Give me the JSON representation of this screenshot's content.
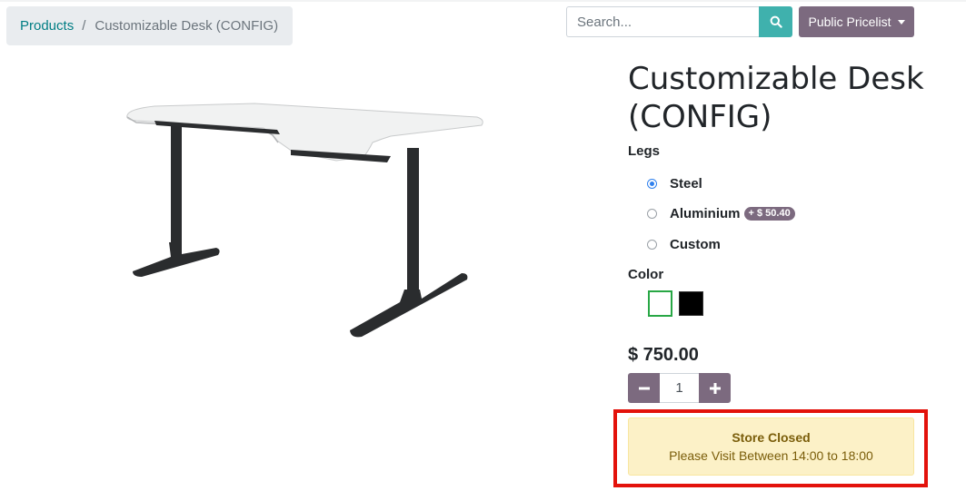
{
  "breadcrumb": {
    "parent": "Products",
    "separator": "/",
    "current": "Customizable Desk (CONFIG)"
  },
  "search": {
    "placeholder": "Search...",
    "value": ""
  },
  "pricelist": {
    "label": "Public Pricelist"
  },
  "product": {
    "title": "Customizable Desk (CONFIG)",
    "price": "$ 750.00",
    "quantity": "1",
    "image_icon": "desk-image"
  },
  "attributes": {
    "legs": {
      "label": "Legs",
      "options": [
        {
          "label": "Steel",
          "selected": true,
          "extra": ""
        },
        {
          "label": "Aluminium",
          "selected": false,
          "extra": "+ $ 50.40"
        },
        {
          "label": "Custom",
          "selected": false,
          "extra": ""
        }
      ]
    },
    "color": {
      "label": "Color",
      "options": [
        {
          "swatch": "#ffffff",
          "selected": true
        },
        {
          "swatch": "#000000",
          "selected": false
        }
      ]
    }
  },
  "alert": {
    "title": "Store Closed",
    "message": "Please Visit Between 14:00 to 18:00"
  },
  "colors": {
    "accent": "#7c6a7f",
    "search_button": "#3fb1ad",
    "link": "#017e84",
    "highlight_frame": "#e3120b",
    "alert_bg": "#fcf1c7",
    "selected_swatch_border": "#28a745"
  }
}
